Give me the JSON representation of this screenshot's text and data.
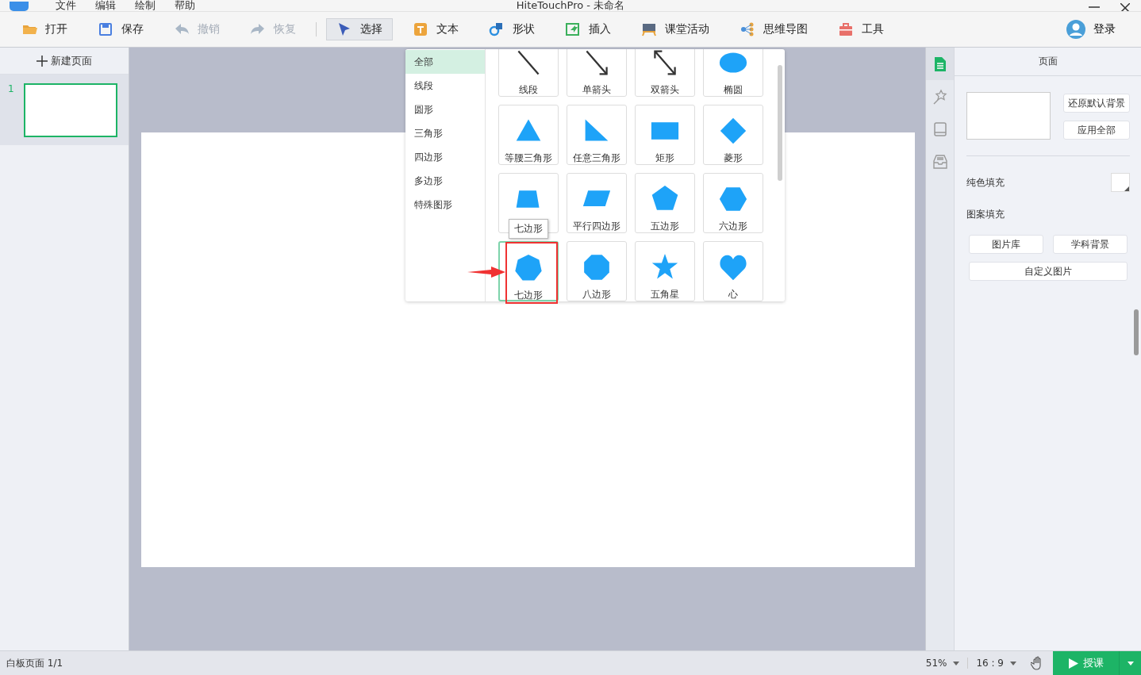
{
  "window": {
    "title": "HiteTouchPro - 未命名"
  },
  "menu": [
    "文件",
    "编辑",
    "绘制",
    "帮助"
  ],
  "toolbar": [
    {
      "kind": "open",
      "label": "打开",
      "disabled": false,
      "selected": false
    },
    {
      "kind": "save",
      "label": "保存",
      "disabled": false,
      "selected": false
    },
    {
      "kind": "undo",
      "label": "撤销",
      "disabled": true,
      "selected": false
    },
    {
      "kind": "redo",
      "label": "恢复",
      "disabled": true,
      "selected": false
    },
    {
      "kind": "select",
      "label": "选择",
      "disabled": false,
      "selected": true
    },
    {
      "kind": "text",
      "label": "文本",
      "disabled": false,
      "selected": false
    },
    {
      "kind": "shape",
      "label": "形状",
      "disabled": false,
      "selected": false
    },
    {
      "kind": "insert",
      "label": "插入",
      "disabled": false,
      "selected": false
    },
    {
      "kind": "class",
      "label": "课堂活动",
      "disabled": false,
      "selected": false
    },
    {
      "kind": "mindmap",
      "label": "思维导图",
      "disabled": false,
      "selected": false
    },
    {
      "kind": "tools",
      "label": "工具",
      "disabled": false,
      "selected": false
    }
  ],
  "login": "登录",
  "pages": {
    "new_page": "新建页面",
    "items": [
      {
        "number": "1",
        "selected": true
      }
    ]
  },
  "shape_picker": {
    "categories": [
      {
        "label": "全部",
        "selected": true
      },
      {
        "label": "线段",
        "selected": false
      },
      {
        "label": "圆形",
        "selected": false
      },
      {
        "label": "三角形",
        "selected": false
      },
      {
        "label": "四边形",
        "selected": false
      },
      {
        "label": "多边形",
        "selected": false
      },
      {
        "label": "特殊图形",
        "selected": false
      }
    ],
    "shapes": [
      {
        "kind": "line",
        "label": "线段",
        "selected": false
      },
      {
        "kind": "arrow",
        "label": "单箭头",
        "selected": false
      },
      {
        "kind": "double-arrow",
        "label": "双箭头",
        "selected": false
      },
      {
        "kind": "ellipse",
        "label": "椭圆",
        "selected": false
      },
      {
        "kind": "triangle",
        "label": "等腰三角形",
        "selected": false
      },
      {
        "kind": "right-triangle",
        "label": "任意三角形",
        "selected": false
      },
      {
        "kind": "rectangle",
        "label": "矩形",
        "selected": false
      },
      {
        "kind": "diamond",
        "label": "菱形",
        "selected": false
      },
      {
        "kind": "trapezoid",
        "selected": false
      },
      {
        "kind": "parallelogram",
        "label": "平行四边形",
        "selected": false
      },
      {
        "kind": "pentagon",
        "label": "五边形",
        "selected": false
      },
      {
        "kind": "hexagon",
        "label": "六边形",
        "selected": false
      },
      {
        "kind": "heptagon",
        "label": "七边形",
        "selected": true
      },
      {
        "kind": "octagon",
        "label": "八边形",
        "selected": false
      },
      {
        "kind": "star",
        "label": "五角星",
        "selected": false
      },
      {
        "kind": "heart",
        "label": "心",
        "selected": false
      }
    ],
    "tooltip": "七边形"
  },
  "side_tabs": [
    {
      "kind": "page",
      "selected": true
    },
    {
      "kind": "wand",
      "selected": false
    },
    {
      "kind": "book",
      "selected": false
    },
    {
      "kind": "tray",
      "selected": false
    }
  ],
  "panel": {
    "title": "页面",
    "restore_button": "还原默认背景",
    "apply_all_button": "应用全部",
    "solid_fill": "纯色填充",
    "pattern_fill": "图案填充",
    "pattern_buttons": [
      "图片库",
      "学科背景"
    ],
    "custom_button": "自定义图片"
  },
  "status_bar": {
    "page": "白板页面 1/1",
    "zoom": "51%",
    "ratio": "16 : 9",
    "teach_button": "授课"
  }
}
